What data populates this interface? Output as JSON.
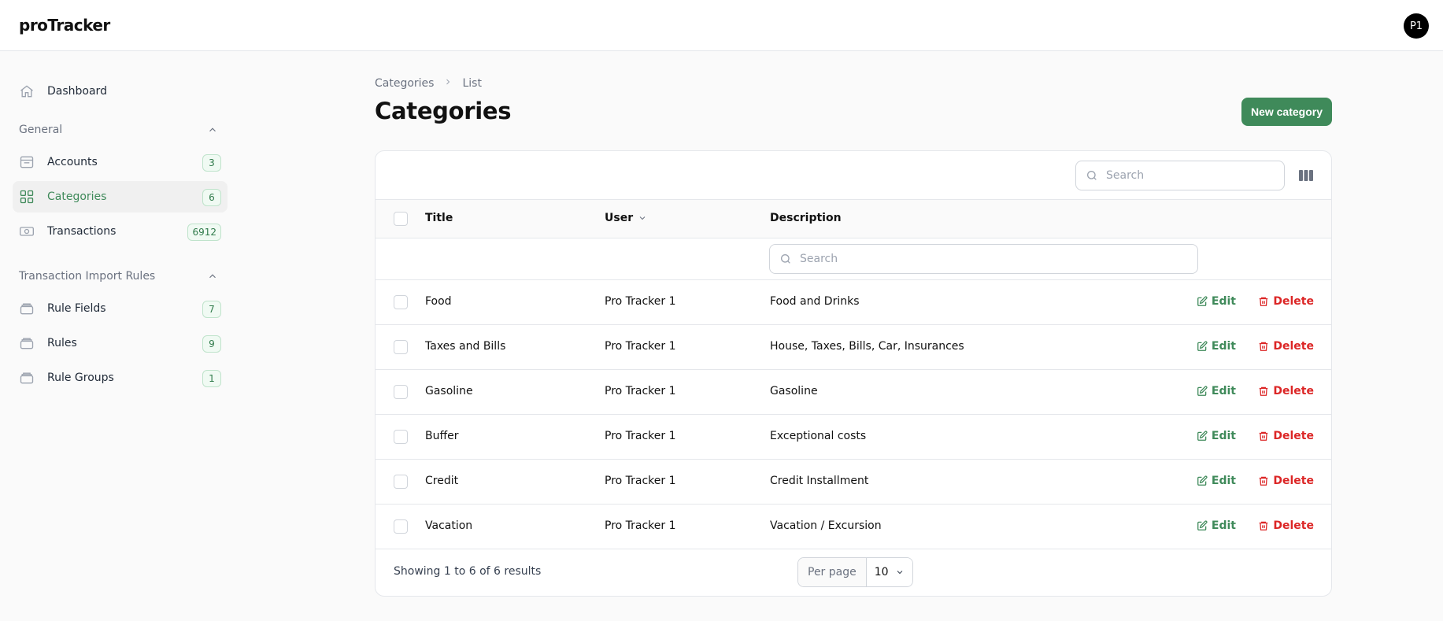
{
  "app": {
    "brand": "proTracker",
    "avatar_initials": "P1"
  },
  "sidebar": {
    "dashboard": {
      "label": "Dashboard"
    },
    "general": {
      "heading": "General",
      "items": [
        {
          "label": "Accounts",
          "badge": "3",
          "icon": "inbox-icon"
        },
        {
          "label": "Categories",
          "badge": "6",
          "icon": "grid-icon",
          "active": true
        },
        {
          "label": "Transactions",
          "badge": "6912",
          "icon": "cash-icon"
        }
      ]
    },
    "import_rules": {
      "heading": "Transaction Import Rules",
      "items": [
        {
          "label": "Rule Fields",
          "badge": "7",
          "icon": "stack-icon"
        },
        {
          "label": "Rules",
          "badge": "9",
          "icon": "stack-icon"
        },
        {
          "label": "Rule Groups",
          "badge": "1",
          "icon": "stack-icon"
        }
      ]
    }
  },
  "breadcrumb": {
    "parent": "Categories",
    "current": "List"
  },
  "page": {
    "title": "Categories",
    "new_button": "New category"
  },
  "table": {
    "search_placeholder": "Search",
    "columns": {
      "title": "Title",
      "user": "User",
      "description": "Description"
    },
    "filter_placeholder": "Search",
    "rows": [
      {
        "title": "Food",
        "user": "Pro Tracker 1",
        "description": "Food and Drinks"
      },
      {
        "title": "Taxes and Bills",
        "user": "Pro Tracker 1",
        "description": "House, Taxes, Bills, Car, Insurances"
      },
      {
        "title": "Gasoline",
        "user": "Pro Tracker 1",
        "description": "Gasoline"
      },
      {
        "title": "Buffer",
        "user": "Pro Tracker 1",
        "description": "Exceptional costs"
      },
      {
        "title": "Credit",
        "user": "Pro Tracker 1",
        "description": "Credit Installment"
      },
      {
        "title": "Vacation",
        "user": "Pro Tracker 1",
        "description": "Vacation / Excursion"
      }
    ],
    "actions": {
      "edit": "Edit",
      "delete": "Delete"
    },
    "footer": {
      "showing": "Showing 1 to 6 of 6 results",
      "per_page_label": "Per page",
      "per_page_value": "10"
    }
  },
  "colors": {
    "accent": "#3f8a5a",
    "danger": "#dc2626"
  }
}
